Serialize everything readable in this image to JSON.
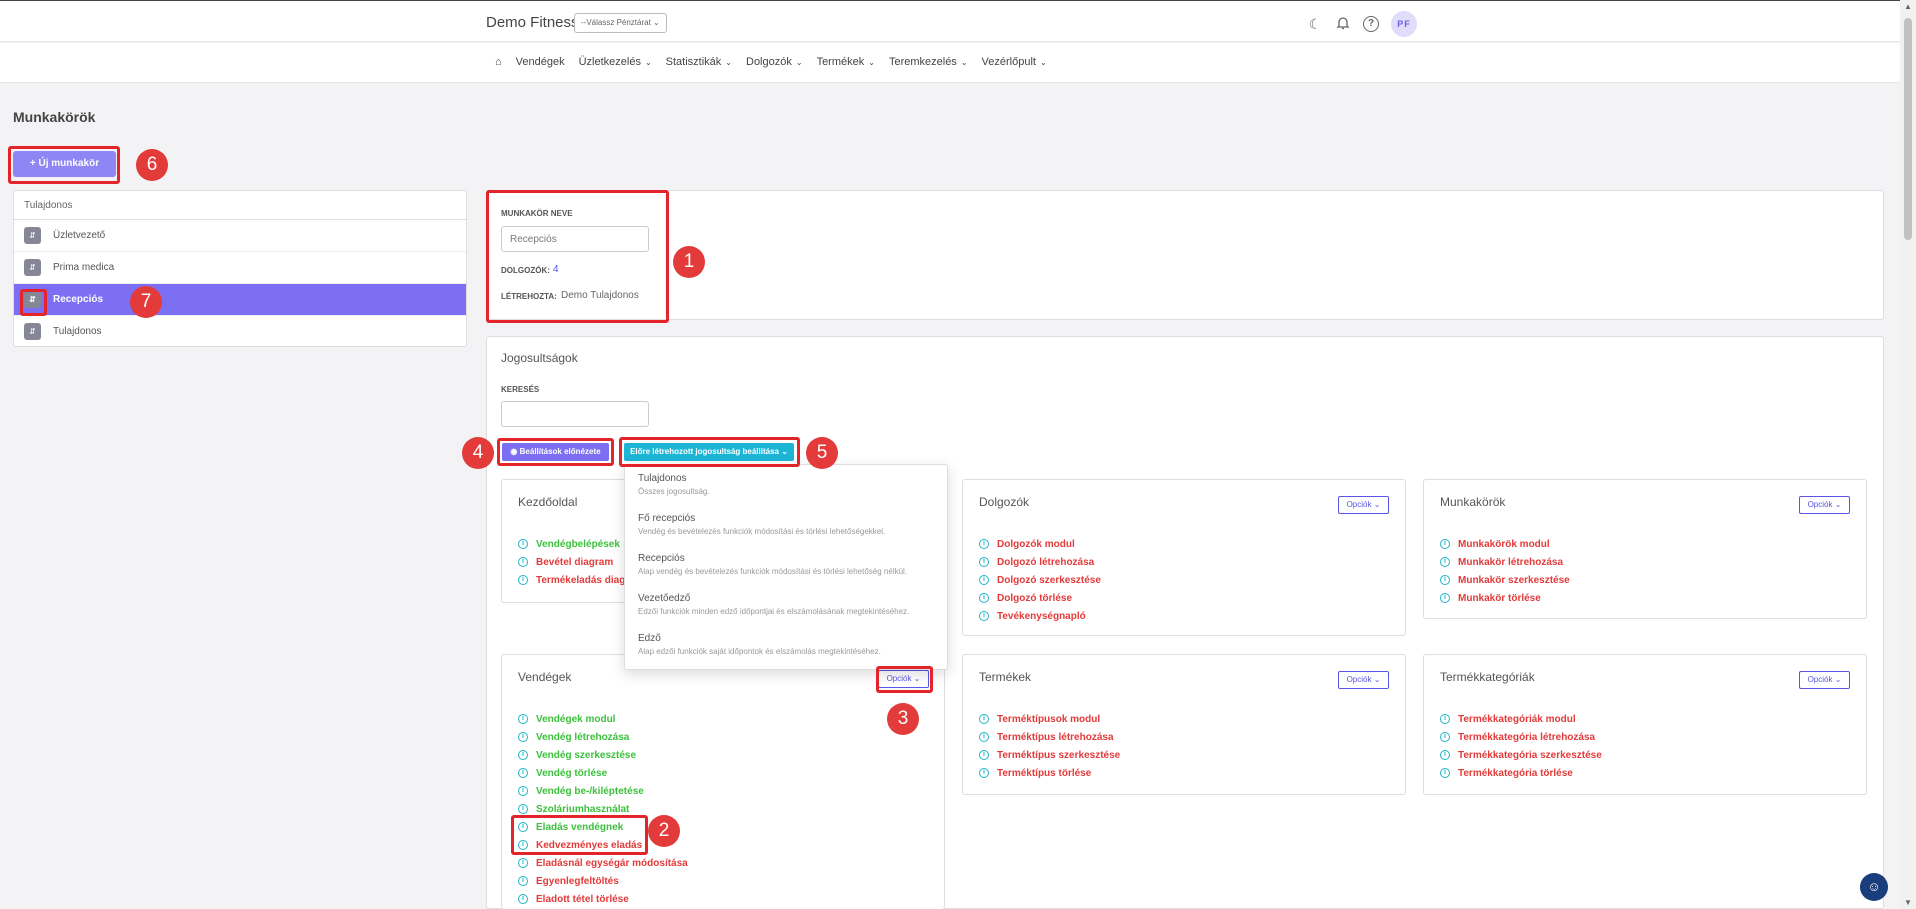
{
  "header": {
    "brand": "Demo Fitness",
    "cashier_select": "--Válassz Pénztárat",
    "avatar": "PF"
  },
  "nav": {
    "home_icon": "home-icon",
    "items": [
      {
        "label": "Vendégek"
      },
      {
        "label": "Üzletkezelés"
      },
      {
        "label": "Statisztikák"
      },
      {
        "label": "Dolgozók"
      },
      {
        "label": "Termékek"
      },
      {
        "label": "Teremkezelés"
      },
      {
        "label": "Vezérlőpult"
      }
    ]
  },
  "page": {
    "title": "Munkakörök",
    "new_button": "Új munkakör"
  },
  "roles": {
    "header": "Tulajdonos",
    "items": [
      {
        "label": "Üzletvezető",
        "active": false
      },
      {
        "label": "Prima medica",
        "active": false
      },
      {
        "label": "Recepciós",
        "active": true
      },
      {
        "label": "Tulajdonos",
        "active": false
      }
    ]
  },
  "details": {
    "name_label": "MUNKAKÖR NEVE",
    "name_value": "Recepciós",
    "workers_label": "DOLGOZÓK:",
    "workers_count": "4",
    "created_label": "LÉTREHOZTA:",
    "created_by": "Demo Tulajdonos"
  },
  "permissions": {
    "title": "Jogosultságok",
    "search_label": "KERESÉS",
    "preview_button": "Beállítások előnézete",
    "preset_button": "Előre létrehozott jogosultság beállítása",
    "options_label": "Opciók"
  },
  "presets": [
    {
      "title": "Tulajdonos",
      "desc": "Összes jogosultság."
    },
    {
      "title": "Fő recepciós",
      "desc": "Vendég és bevételezés funkciók módosítási és törlési lehetőségekkel."
    },
    {
      "title": "Recepciós",
      "desc": "Alap vendég és bevételezés funkciók módosítási és törlési lehetőség nélkül."
    },
    {
      "title": "Vezetőedző",
      "desc": "Edzői funkciók minden edző időpontjai és elszámolásának megtekintéséhez."
    },
    {
      "title": "Edző",
      "desc": "Alap edzői funkciók saját időpontok és elszámolás megtekintéséhez."
    }
  ],
  "modules": {
    "kezdooldal": {
      "title": "Kezdőoldal",
      "items": [
        {
          "label": "Vendégbelépések",
          "on": true
        },
        {
          "label": "Bevétel diagram",
          "on": false
        },
        {
          "label": "Termékeladás diag",
          "on": false
        }
      ]
    },
    "dolgozok": {
      "title": "Dolgozók",
      "items": [
        {
          "label": "Dolgozók modul",
          "on": false
        },
        {
          "label": "Dolgozó létrehozása",
          "on": false
        },
        {
          "label": "Dolgozó szerkesztése",
          "on": false
        },
        {
          "label": "Dolgozó törlése",
          "on": false
        },
        {
          "label": "Tevékenységnapló",
          "on": false
        }
      ]
    },
    "munkakorok": {
      "title": "Munkakörök",
      "items": [
        {
          "label": "Munkakörök modul",
          "on": false
        },
        {
          "label": "Munkakör létrehozása",
          "on": false
        },
        {
          "label": "Munkakör szerkesztése",
          "on": false
        },
        {
          "label": "Munkakör törlése",
          "on": false
        }
      ]
    },
    "vendegek": {
      "title": "Vendégek",
      "items": [
        {
          "label": "Vendégek modul",
          "on": true
        },
        {
          "label": "Vendég létrehozása",
          "on": true
        },
        {
          "label": "Vendég szerkesztése",
          "on": true
        },
        {
          "label": "Vendég törlése",
          "on": true
        },
        {
          "label": "Vendég be-/kiléptetése",
          "on": true
        },
        {
          "label": "Szoláriumhasználat",
          "on": true
        },
        {
          "label": "Eladás vendégnek",
          "on": true
        },
        {
          "label": "Kedvezményes eladás",
          "on": false
        },
        {
          "label": "Eladásnál egységár módosítása",
          "on": false
        },
        {
          "label": "Egyenlegfeltöltés",
          "on": false
        },
        {
          "label": "Eladott tétel törlése",
          "on": false
        }
      ]
    },
    "termekek": {
      "title": "Termékek",
      "items": [
        {
          "label": "Terméktípusok modul",
          "on": false
        },
        {
          "label": "Terméktípus létrehozása",
          "on": false
        },
        {
          "label": "Terméktípus szerkesztése",
          "on": false
        },
        {
          "label": "Terméktípus törlése",
          "on": false
        }
      ]
    },
    "termekkategoriak": {
      "title": "Termékkategóriák",
      "items": [
        {
          "label": "Termékkategóriák modul",
          "on": false
        },
        {
          "label": "Termékkategória létrehozása",
          "on": false
        },
        {
          "label": "Termékkategória szerkesztése",
          "on": false
        },
        {
          "label": "Termékkategória törlése",
          "on": false
        }
      ]
    }
  },
  "annotations": [
    "1",
    "2",
    "3",
    "4",
    "5",
    "6",
    "7"
  ],
  "colors": {
    "accent": "#7c6ff3",
    "cyan": "#1cb5d6",
    "enabled": "#3cc13c",
    "disabled": "#e33a3a",
    "highlight": "#e3242b"
  }
}
